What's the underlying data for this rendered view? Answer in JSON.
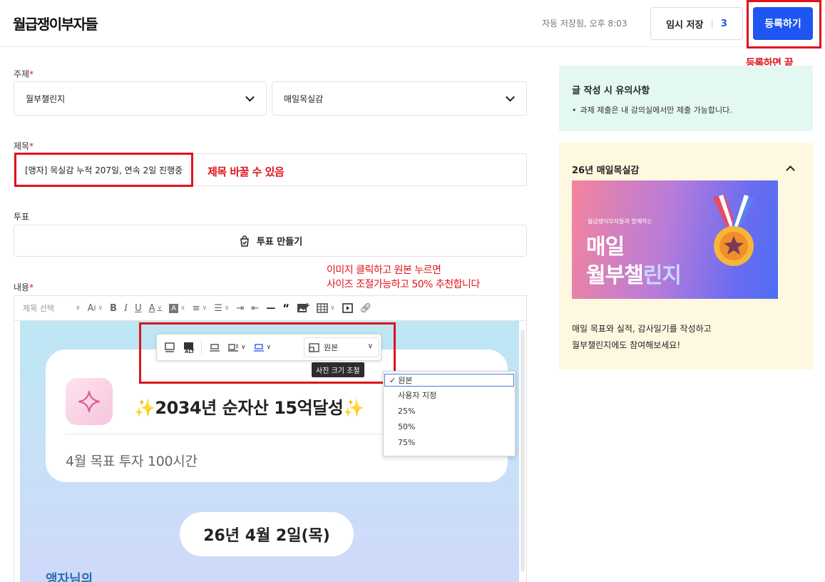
{
  "header": {
    "logo": "월급쟁이부자들",
    "autosave_text": "자동 저장됨, 오후 8:03",
    "draft_label": "임시 저장",
    "draft_count": "3",
    "submit_label": "등록하기"
  },
  "annotations": {
    "submit_note": "등록하면 끝",
    "title_note": "제목 바꿀 수 있음",
    "image_note_line1": "이미지 클릭하고 원본 누르면",
    "image_note_line2": "사이즈 조절가능하고 50% 추천합니다",
    "annotation_color": "#e0141b"
  },
  "form": {
    "topic_label": "주제",
    "topic_select1": "월부챌린지",
    "topic_select2": "매일목실감",
    "title_label": "제목",
    "title_value": "[앵자] 목실감 누적 207일, 연속 2일 진행중",
    "vote_label": "투표",
    "vote_button": "투표 만들기",
    "content_label": "내용",
    "required_mark": "*"
  },
  "toolbar": {
    "heading_select": "제목 선택"
  },
  "editor_image": {
    "goal_main": "✨2034년 순자산 15억달성✨",
    "goal_sub": "4월 목표  투자 100시간",
    "date": "26년 4월 2일(목)",
    "bottom_text": "앵자님의"
  },
  "image_toolbar": {
    "size_value": "원본",
    "tooltip": "사진 크기 조절",
    "options": [
      "원본",
      "사용자 지정",
      "25%",
      "50%",
      "75%"
    ],
    "selected_index": 0
  },
  "sidebar": {
    "notice_title": "글 작성 시 유의사항",
    "notice_item": "과제 제출은 내 강의실에서만 제출 가능합니다.",
    "challenge_title": "26년 매일목실감",
    "banner_kicker": "월급쟁이부자들과 함께하는",
    "banner_line1": "매일",
    "banner_line2_a": "월부챌",
    "banner_line2_b": "린지",
    "challenge_desc_line1": "매일 목표와 실적, 감사일기를 작성하고",
    "challenge_desc_line2": "월부챌린지에도 참여해보세요!"
  },
  "colors": {
    "primary": "#1f55f0",
    "notice_bg": "#e3f8f0",
    "challenge_bg": "#fff8e0"
  }
}
